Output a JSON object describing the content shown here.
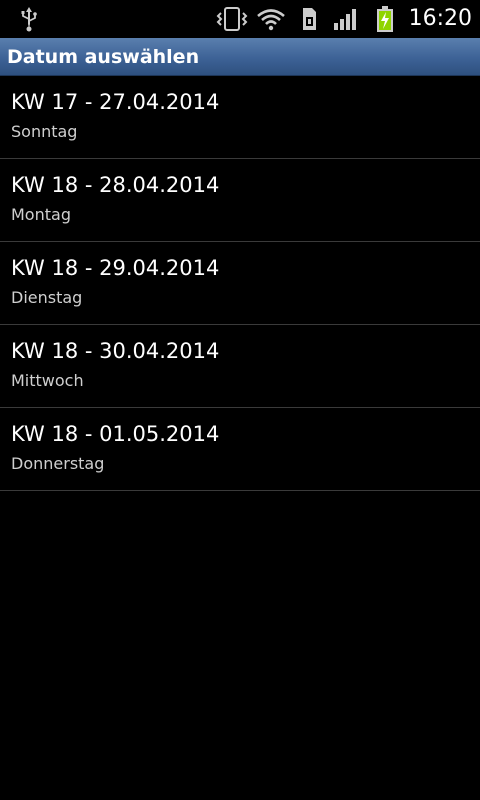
{
  "status_bar": {
    "time": "16:20",
    "icons": [
      "usb-icon",
      "vibrate-icon",
      "wifi-icon",
      "sim-icon",
      "signal-icon",
      "battery-charging-icon"
    ]
  },
  "title_bar": {
    "title": "Datum auswählen"
  },
  "dates": [
    {
      "label": "KW 17 - 27.04.2014",
      "weekday": "Sonntag"
    },
    {
      "label": "KW 18 - 28.04.2014",
      "weekday": "Montag"
    },
    {
      "label": "KW 18 - 29.04.2014",
      "weekday": "Dienstag"
    },
    {
      "label": "KW 18 - 30.04.2014",
      "weekday": "Mittwoch"
    },
    {
      "label": "KW 18 - 01.05.2014",
      "weekday": "Donnerstag"
    }
  ],
  "colors": {
    "title_bar": "#3d6296",
    "background": "#000000",
    "battery": "#8fd400"
  }
}
